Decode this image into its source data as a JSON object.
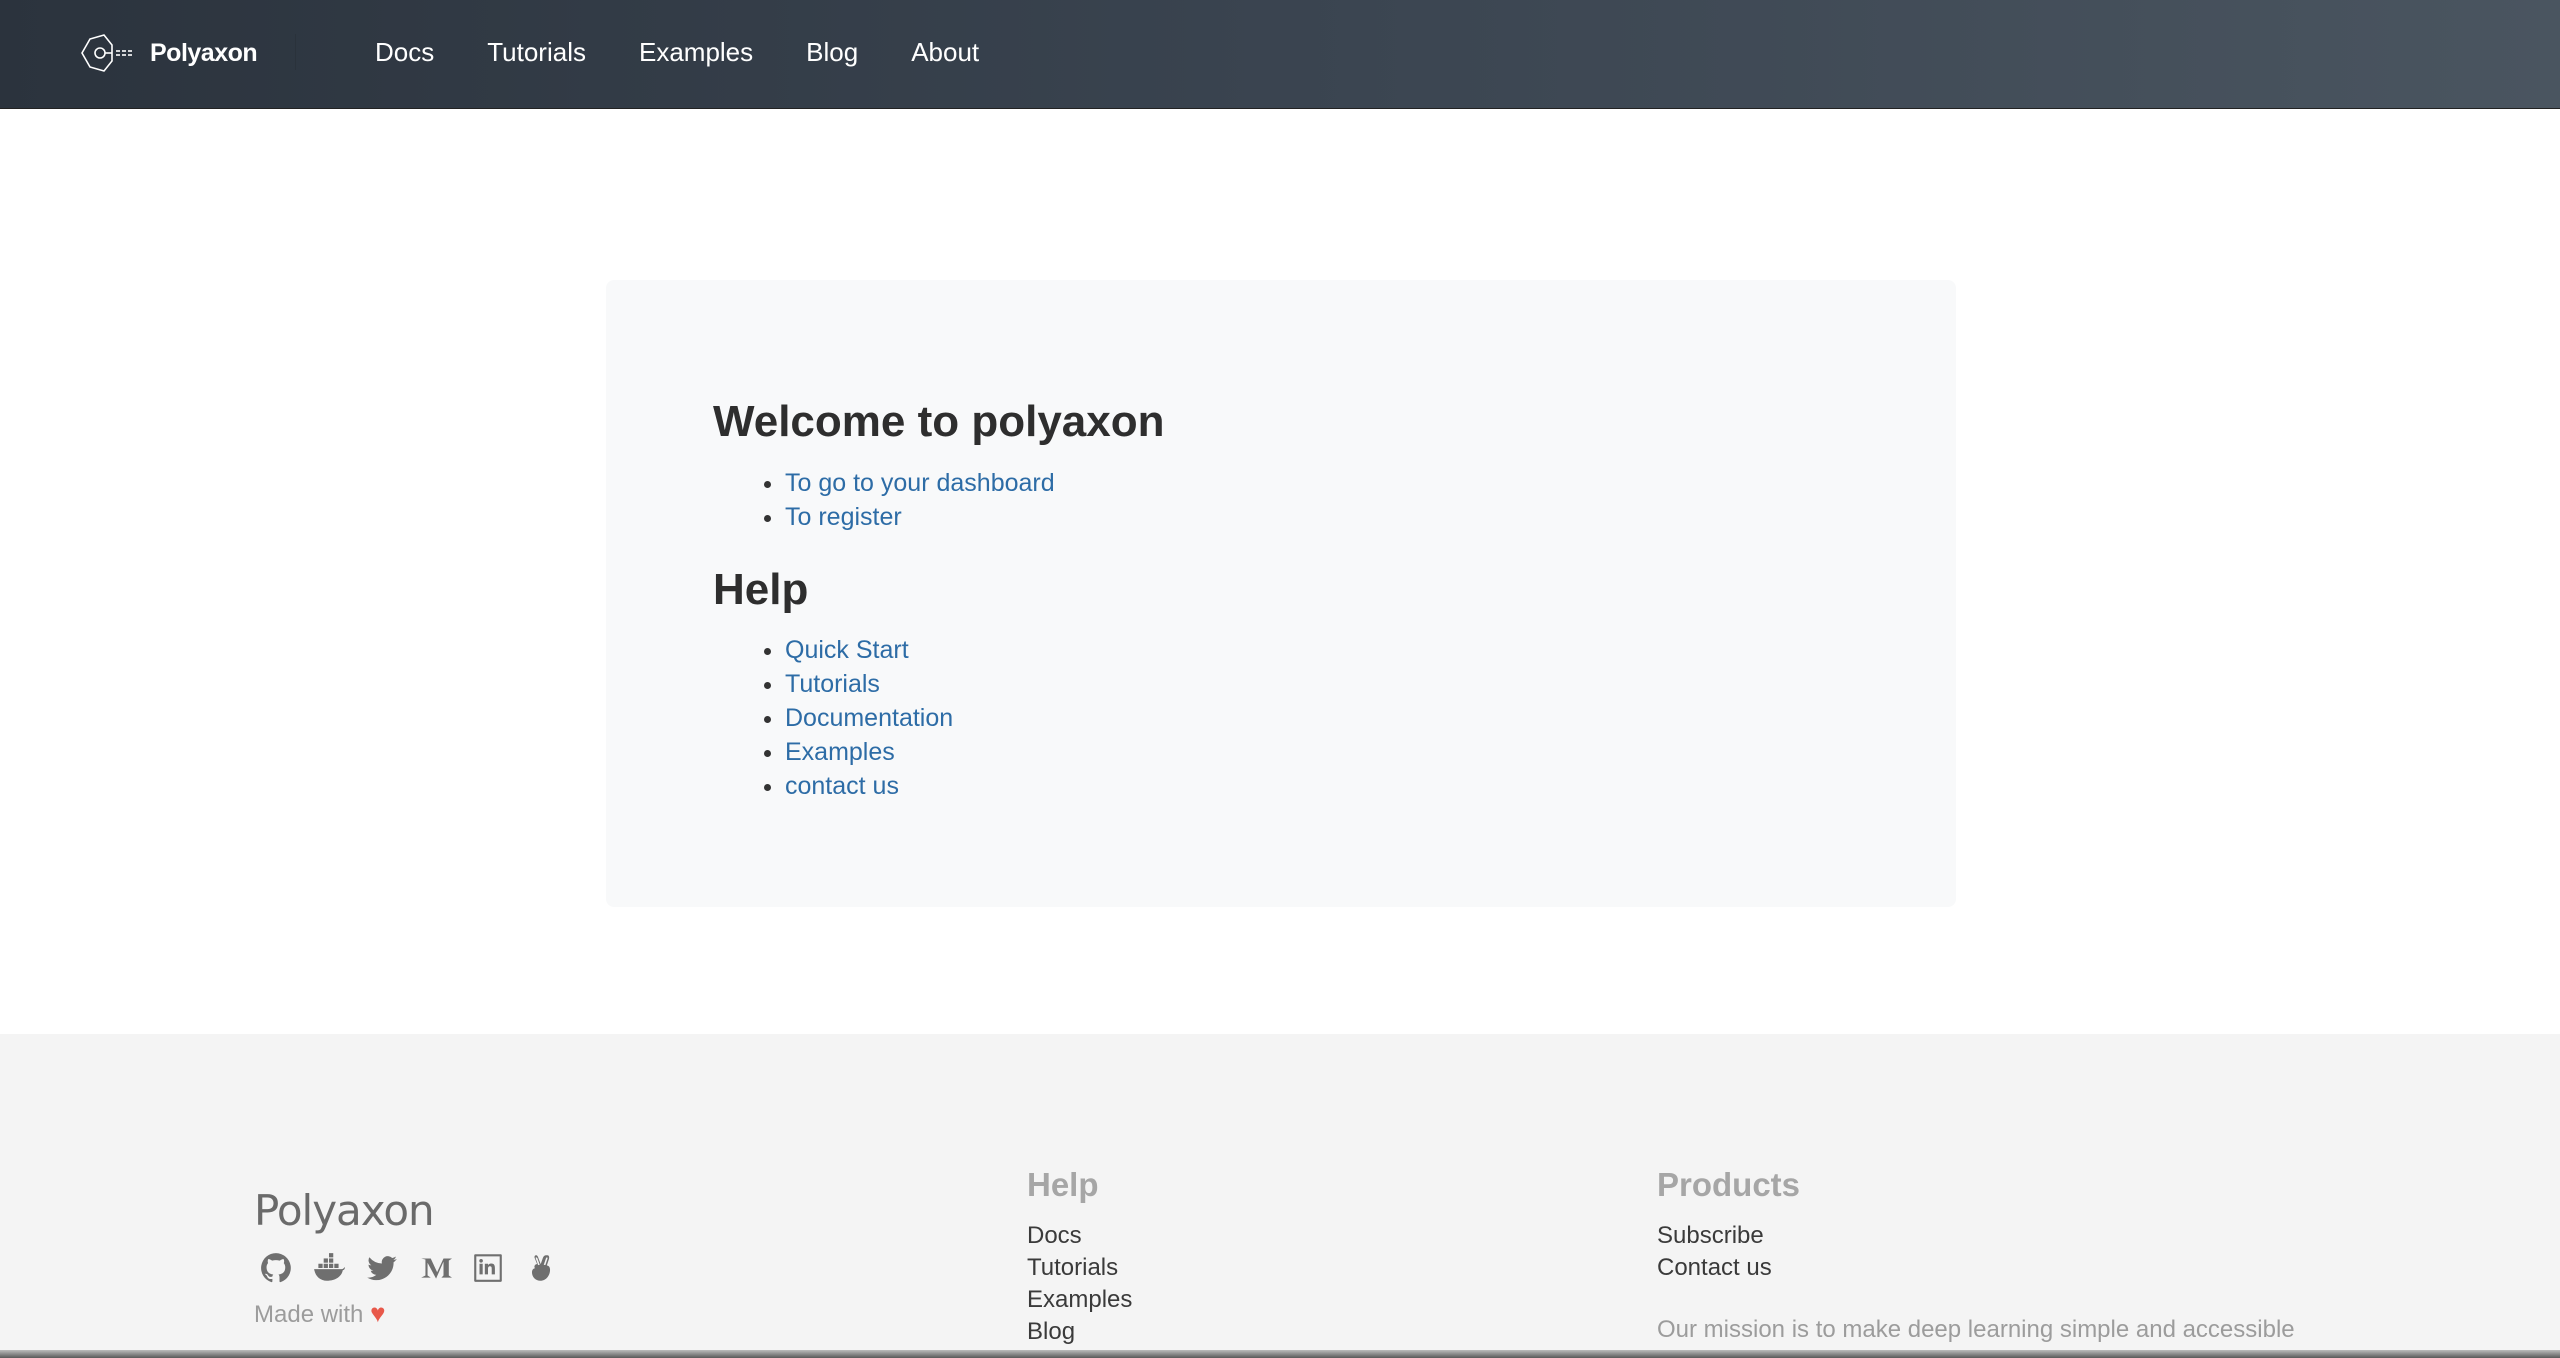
{
  "navbar": {
    "brand": "Polyaxon",
    "links": [
      "Docs",
      "Tutorials",
      "Examples",
      "Blog",
      "About"
    ]
  },
  "welcome": {
    "title": "Welcome to polyaxon",
    "links": [
      "To go to your dashboard",
      "To register"
    ]
  },
  "help": {
    "title": "Help",
    "links": [
      "Quick Start",
      "Tutorials",
      "Documentation",
      "Examples",
      "contact us"
    ]
  },
  "footer": {
    "brand": "Polyaxon",
    "social_icons": [
      "github-icon",
      "docker-icon",
      "twitter-icon",
      "medium-icon",
      "linkedin-icon",
      "angellist-icon"
    ],
    "made_with": "Made with",
    "heart": "♥",
    "help_title": "Help",
    "help_links": [
      "Docs",
      "Tutorials",
      "Examples",
      "Blog"
    ],
    "products_title": "Products",
    "products_links": [
      "Subscribe",
      "Contact us"
    ],
    "mission": "Our mission is to make deep learning simple and accessible"
  },
  "colors": {
    "navbar_start": "#2b333d",
    "navbar_end": "#4a5560",
    "link": "#2d6ca6",
    "card_bg": "#f8f9fa",
    "footer_bg": "#f4f4f4",
    "heart": "#e8584a"
  }
}
